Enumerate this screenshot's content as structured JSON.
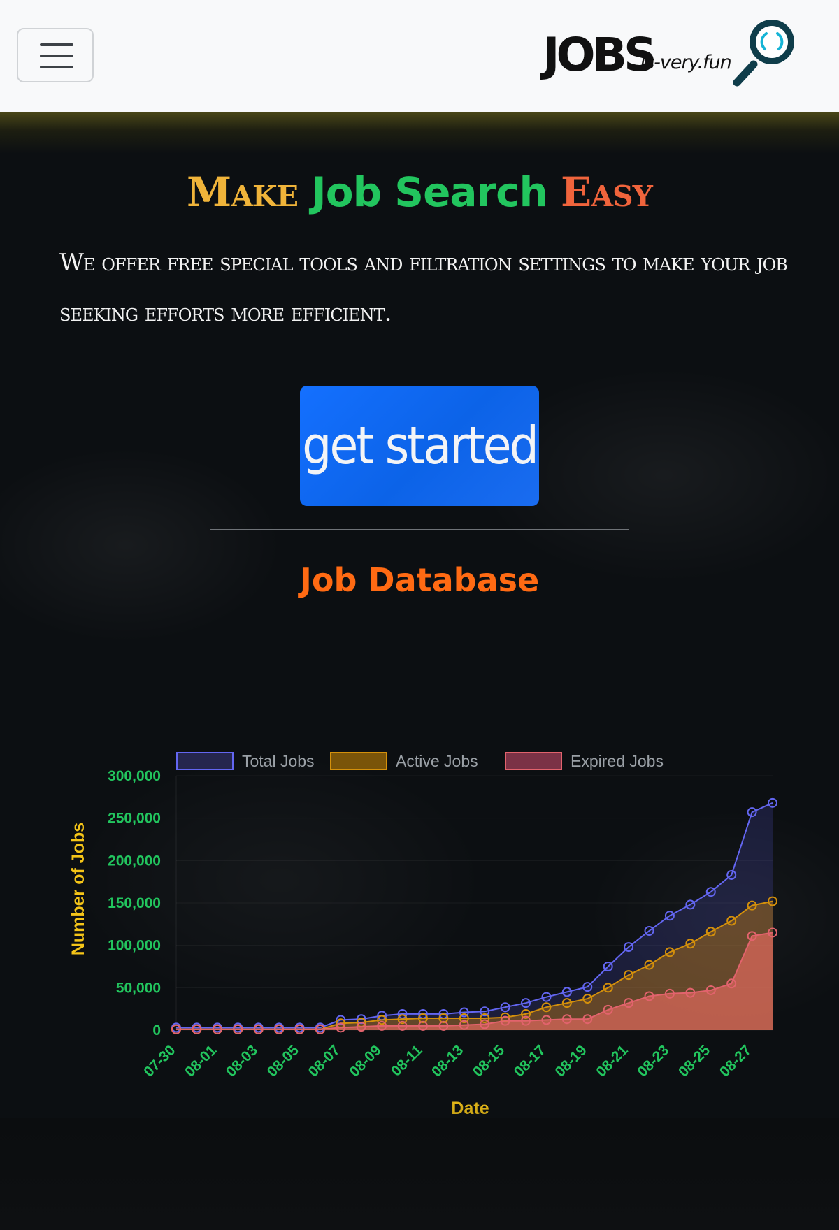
{
  "header": {
    "menu_button": "toggle-navigation",
    "logo": {
      "word": "JOBS",
      "suffix": ".is-very.fun"
    }
  },
  "hero": {
    "headline": {
      "make": "Make",
      "job_search": "Job Search",
      "easy": "Easy"
    },
    "tagline": "We offer free special tools and filtration settings to make your job seeking efforts more efficient.",
    "cta_label": "get started"
  },
  "colors": {
    "cta": "#0d6efd",
    "headline_make": "#f0b43a",
    "headline_job_search": "#22c55e",
    "headline_easy": "#f0643c",
    "chart_title": "#ff6a13",
    "tick_labels": "#22c55e",
    "axis_titles": "#f5c518"
  },
  "chart_data": {
    "type": "area",
    "title": "Job Database",
    "xlabel": "Date",
    "ylabel": "Number of Jobs",
    "ylim": [
      0,
      300000
    ],
    "y_ticks": [
      0,
      50000,
      100000,
      150000,
      200000,
      250000,
      300000
    ],
    "y_tick_labels": [
      "0",
      "50,000",
      "100,000",
      "150,000",
      "200,000",
      "250,000",
      "300,000"
    ],
    "legend_position": "top",
    "x": [
      "07-30",
      "07-31",
      "08-01",
      "08-02",
      "08-03",
      "08-04",
      "08-05",
      "08-06",
      "08-07",
      "08-08",
      "08-09",
      "08-10",
      "08-11",
      "08-12",
      "08-13",
      "08-14",
      "08-15",
      "08-16",
      "08-17",
      "08-18",
      "08-19",
      "08-20",
      "08-21",
      "08-22",
      "08-23",
      "08-24",
      "08-25",
      "08-26",
      "08-27",
      "08-28"
    ],
    "x_tick_labels": [
      "07-30",
      "08-01",
      "08-03",
      "08-05",
      "08-07",
      "08-09",
      "08-11",
      "08-13",
      "08-15",
      "08-17",
      "08-19",
      "08-21",
      "08-23",
      "08-25",
      "08-27"
    ],
    "series": [
      {
        "name": "Total Jobs",
        "color": "#6366f1",
        "values": [
          3000,
          3000,
          3000,
          3000,
          3000,
          3000,
          3000,
          3000,
          12000,
          13000,
          17000,
          19000,
          19000,
          19000,
          21000,
          22000,
          27000,
          32000,
          39000,
          45000,
          51000,
          75000,
          98000,
          117000,
          135000,
          148000,
          163000,
          183000,
          257000,
          268000
        ]
      },
      {
        "name": "Active Jobs",
        "color": "#d4900b",
        "values": [
          1000,
          1000,
          1000,
          1000,
          1000,
          1000,
          1000,
          1000,
          8000,
          9000,
          12000,
          13000,
          14000,
          14000,
          14000,
          14000,
          15000,
          19000,
          27000,
          32000,
          37000,
          50000,
          65000,
          77000,
          92000,
          102000,
          116000,
          129000,
          147000,
          152000
        ]
      },
      {
        "name": "Expired Jobs",
        "color": "#e2636d",
        "values": [
          1000,
          1000,
          1000,
          1000,
          1000,
          1000,
          1000,
          1000,
          3000,
          4000,
          5000,
          5000,
          5000,
          5000,
          6000,
          7000,
          11000,
          11000,
          12000,
          13000,
          13000,
          24000,
          32000,
          40000,
          43000,
          44000,
          47000,
          55000,
          111000,
          115000
        ]
      }
    ]
  }
}
